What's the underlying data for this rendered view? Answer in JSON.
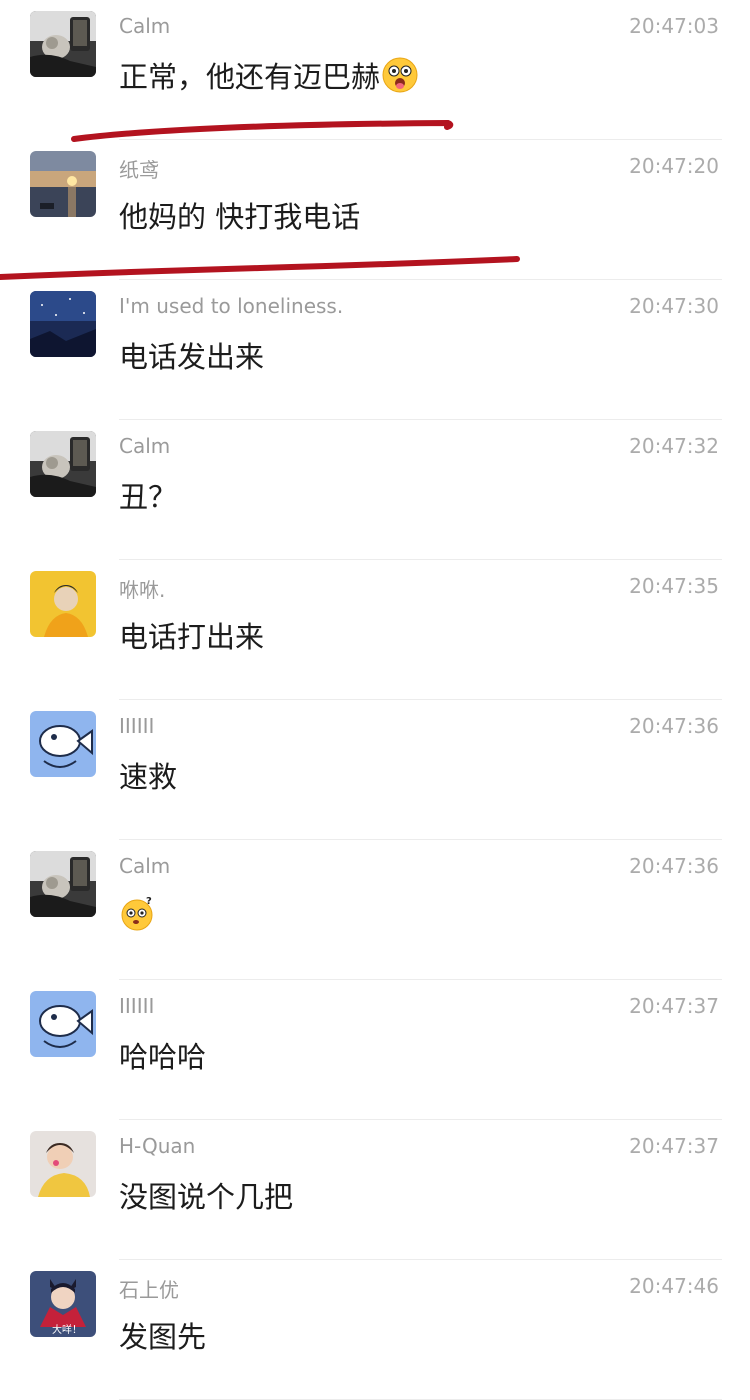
{
  "messages": [
    {
      "sender": "Calm",
      "time": "20:47:03",
      "text": "正常，他还有迈巴赫",
      "emoji": "shocked-tongue-emoji",
      "avatar": "cat-selfie-avatar"
    },
    {
      "sender": "纸鸢",
      "time": "20:47:20",
      "text": "他妈的 快打我电话",
      "avatar": "sunset-lake-avatar"
    },
    {
      "sender": "I'm used to loneliness.",
      "time": "20:47:30",
      "text": "电话发出来",
      "avatar": "night-sky-avatar"
    },
    {
      "sender": "Calm",
      "time": "20:47:32",
      "text": "丑？",
      "avatar": "cat-selfie-avatar"
    },
    {
      "sender": "咻咻.",
      "time": "20:47:35",
      "text": "电话打出来",
      "avatar": "yellow-portrait-avatar"
    },
    {
      "sender": "IIIIII",
      "time": "20:47:36",
      "text": "速救",
      "avatar": "cartoon-fish-avatar"
    },
    {
      "sender": "Calm",
      "time": "20:47:36",
      "text": "",
      "emoji": "confused-question-emoji",
      "avatar": "cat-selfie-avatar"
    },
    {
      "sender": "IIIIII",
      "time": "20:47:37",
      "text": "哈哈哈",
      "avatar": "cartoon-fish-avatar"
    },
    {
      "sender": "H-Quan",
      "time": "20:47:37",
      "text": "没图说个几把",
      "avatar": "baby-photo-avatar"
    },
    {
      "sender": "石上优",
      "time": "20:47:46",
      "text": "发图先",
      "avatar": "anime-character-avatar",
      "avatar_caption": "大咩！"
    }
  ],
  "colors": {
    "sender": "#9a9a9a",
    "time": "#ababab",
    "text": "#1c1c1c",
    "divider": "#ececec",
    "underline_ink": "#b3131f"
  }
}
